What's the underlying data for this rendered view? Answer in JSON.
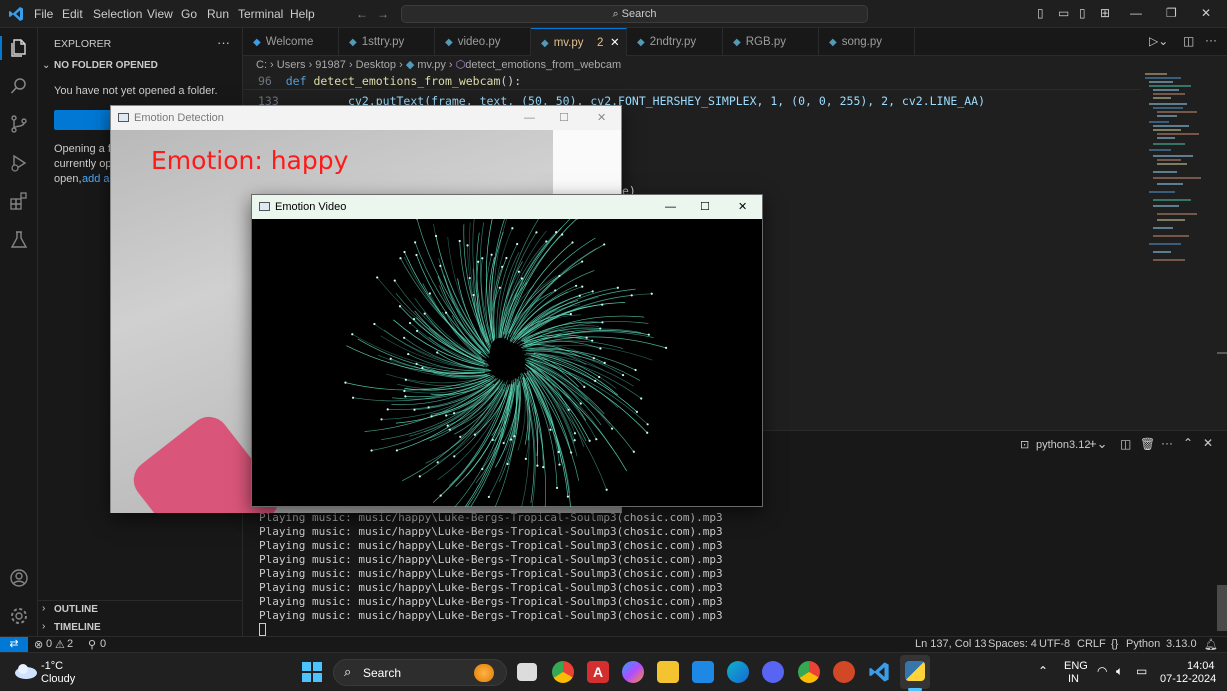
{
  "menu": [
    "File",
    "Edit",
    "Selection",
    "View",
    "Go",
    "Run",
    "Terminal",
    "Help"
  ],
  "search": {
    "label": "Search"
  },
  "sidebar": {
    "title": "EXPLORER",
    "more": "···",
    "section": "NO FOLDER OPENED",
    "msg1": "You have not yet opened a folder.",
    "msg2a": "Opening a fo",
    "msg2b": "currently op",
    "msg2c": "open,",
    "msg2c_link": "add a",
    "outline": "OUTLINE",
    "timeline": "TIMELINE"
  },
  "tabs": [
    {
      "label": "Welcome",
      "icon": "vscode-icon"
    },
    {
      "label": "1sttry.py",
      "icon": "python-icon"
    },
    {
      "label": "video.py",
      "icon": "python-icon"
    },
    {
      "label": "mv.py",
      "icon": "python-icon",
      "badge": "2"
    },
    {
      "label": "2ndtry.py",
      "icon": "python-icon"
    },
    {
      "label": "RGB.py",
      "icon": "python-icon"
    },
    {
      "label": "song.py",
      "icon": "python-icon"
    }
  ],
  "breadcrumb": {
    "c": "C:",
    "users": "Users",
    "user": "91987",
    "desktop": "Desktop",
    "file": "mv.py",
    "symbol": "detect_emotions_from_webcam"
  },
  "code": {
    "line96_no": "96",
    "line96_kw": "def",
    "line96_fn": "detect_emotions_from_webcam",
    "line96_tail": "():",
    "line133_no": "133",
    "line133_text": "cv2.putText(frame, text, (50, 50), cv2.FONT_HERSHEY_SIMPLEX, 1, (0, 0, 255), 2, cv2.LINE_AA)",
    "fragment1": "e)"
  },
  "panel": {
    "terminal_label": "python3.12",
    "lines": [
      "Playing music: music/happy\\Luke-Bergs-Tropical-Soulmp3(chosic.com).mp3",
      "Playing music: music/happy\\Luke-Bergs-Tropical-Soulmp3(chosic.com).mp3",
      "Playing music: music/happy\\Luke-Bergs-Tropical-Soulmp3(chosic.com).mp3",
      "Playing music: music/happy\\Luke-Bergs-Tropical-Soulmp3(chosic.com).mp3",
      "Playing music: music/happy\\Luke-Bergs-Tropical-Soulmp3(chosic.com).mp3",
      "Playing music: music/happy\\Luke-Bergs-Tropical-Soulmp3(chosic.com).mp3",
      "Playing music: music/happy\\Luke-Bergs-Tropical-Soulmp3(chosic.com).mp3",
      "Playing music: music/happy\\Luke-Bergs-Tropical-Soulmp3(chosic.com).mp3"
    ]
  },
  "statusbar": {
    "errors": "0",
    "warnings": "2",
    "ports": "0",
    "position": "Ln 137, Col 13",
    "spaces": "Spaces: 4",
    "encoding": "UTF-8",
    "eol": "CRLF",
    "language": "Python",
    "version": "3.13.0"
  },
  "emotion_window": {
    "title": "Emotion Detection",
    "overlay": "Emotion: happy"
  },
  "video_window": {
    "title": "Emotion Video"
  },
  "taskbar": {
    "weather_temp": "-1°C",
    "weather_desc": "Cloudy",
    "search": "Search",
    "lang1": "ENG",
    "lang2": "IN",
    "time": "14:04",
    "date": "07-12-2024"
  },
  "colors": {
    "accent": "#0078d4",
    "emotion_text": "#ff1a1a",
    "swirl": "#5fe0c0"
  }
}
